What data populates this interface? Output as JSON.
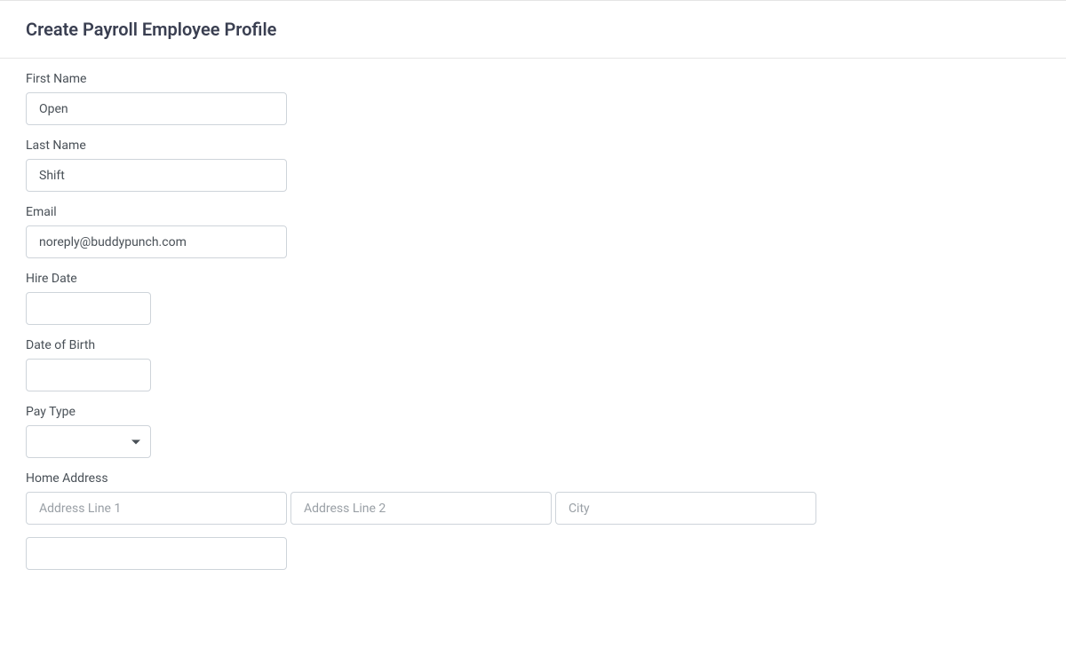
{
  "header": {
    "title": "Create Payroll Employee Profile"
  },
  "form": {
    "firstName": {
      "label": "First Name",
      "value": "Open"
    },
    "lastName": {
      "label": "Last Name",
      "value": "Shift"
    },
    "email": {
      "label": "Email",
      "value": "noreply@buddypunch.com"
    },
    "hireDate": {
      "label": "Hire Date",
      "value": ""
    },
    "dateOfBirth": {
      "label": "Date of Birth",
      "value": ""
    },
    "payType": {
      "label": "Pay Type",
      "value": ""
    },
    "homeAddress": {
      "label": "Home Address",
      "addressLine1": {
        "placeholder": "Address Line 1",
        "value": ""
      },
      "addressLine2": {
        "placeholder": "Address Line 2",
        "value": ""
      },
      "city": {
        "placeholder": "City",
        "value": ""
      }
    }
  }
}
